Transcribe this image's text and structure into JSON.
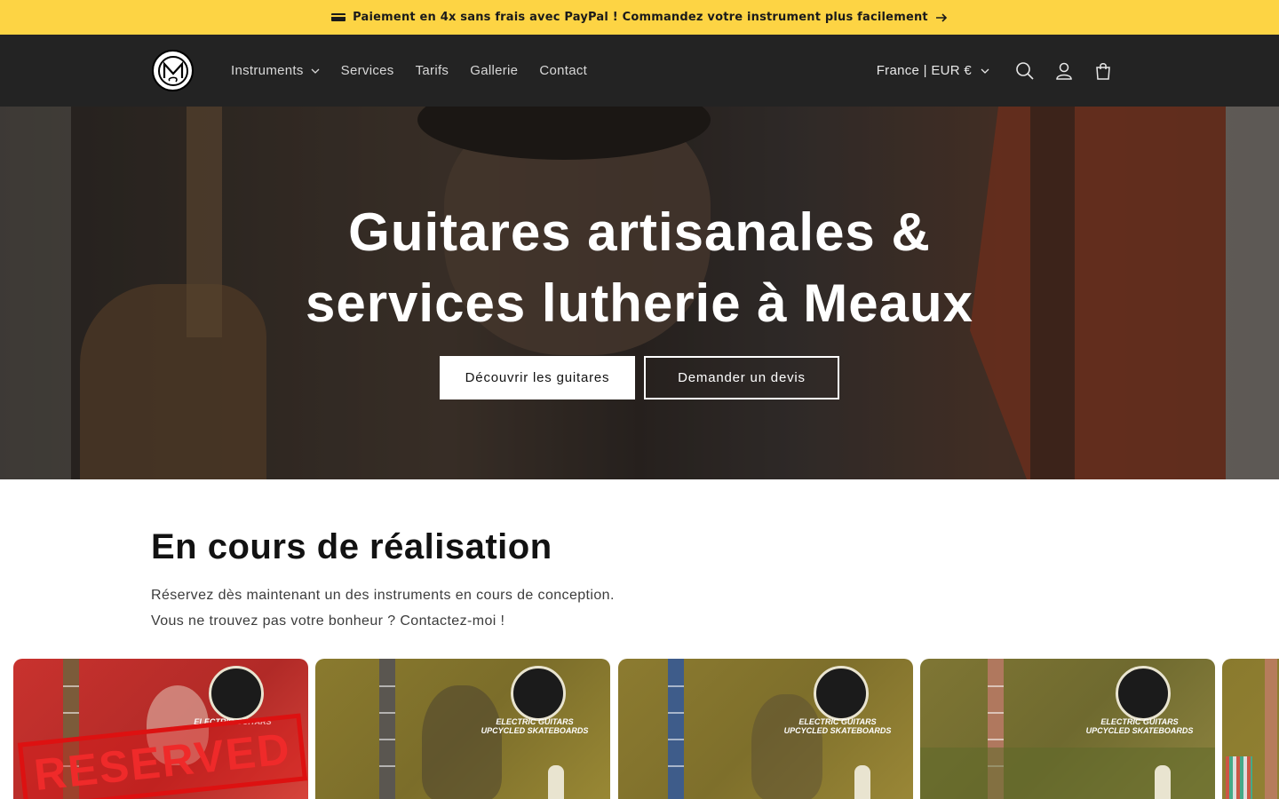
{
  "announcement": {
    "icon": "credit-card-icon",
    "text": "Paiement en 4x sans frais avec PayPal ! Commandez votre instrument plus facilement"
  },
  "header": {
    "logo_icon": "ms-logo-icon",
    "nav": [
      {
        "label": "Instruments",
        "has_dropdown": true
      },
      {
        "label": "Services"
      },
      {
        "label": "Tarifs"
      },
      {
        "label": "Gallerie"
      },
      {
        "label": "Contact"
      }
    ],
    "locale": "France | EUR €",
    "icons": [
      "search-icon",
      "account-icon",
      "cart-icon"
    ]
  },
  "hero": {
    "title_line1": "Guitares artisanales &",
    "title_line2": "services lutherie à Meaux",
    "primary_button": "Découvrir les guitares",
    "secondary_button": "Demander un devis"
  },
  "collection": {
    "title": "En cours de réalisation",
    "desc_line1": "Réservez dès maintenant un des instruments en cours de conception.",
    "desc_line2": "Vous ne trouvez pas votre bonheur ? Contactez-moi !",
    "cards": [
      {
        "caption_1": "ELECTRIC GUITARS",
        "caption_2": "",
        "stamp": "RESERVED",
        "tint": "#c8322e"
      },
      {
        "caption_1": "ELECTRIC GUITARS",
        "caption_2": "UPCYCLED SKATEBOARDS",
        "tint": "#8a7a2e"
      },
      {
        "caption_1": "ELECTRIC GUITARS",
        "caption_2": "UPCYCLED SKATEBOARDS",
        "tint": "#8c7b30"
      },
      {
        "caption_1": "ELECTRIC GUITARS",
        "caption_2": "UPCYCLED SKATEBOARDS",
        "tint": "#7f7634"
      }
    ]
  },
  "colors": {
    "announcement_bg": "#fdd444",
    "header_bg": "#232323",
    "text": "#121212"
  }
}
